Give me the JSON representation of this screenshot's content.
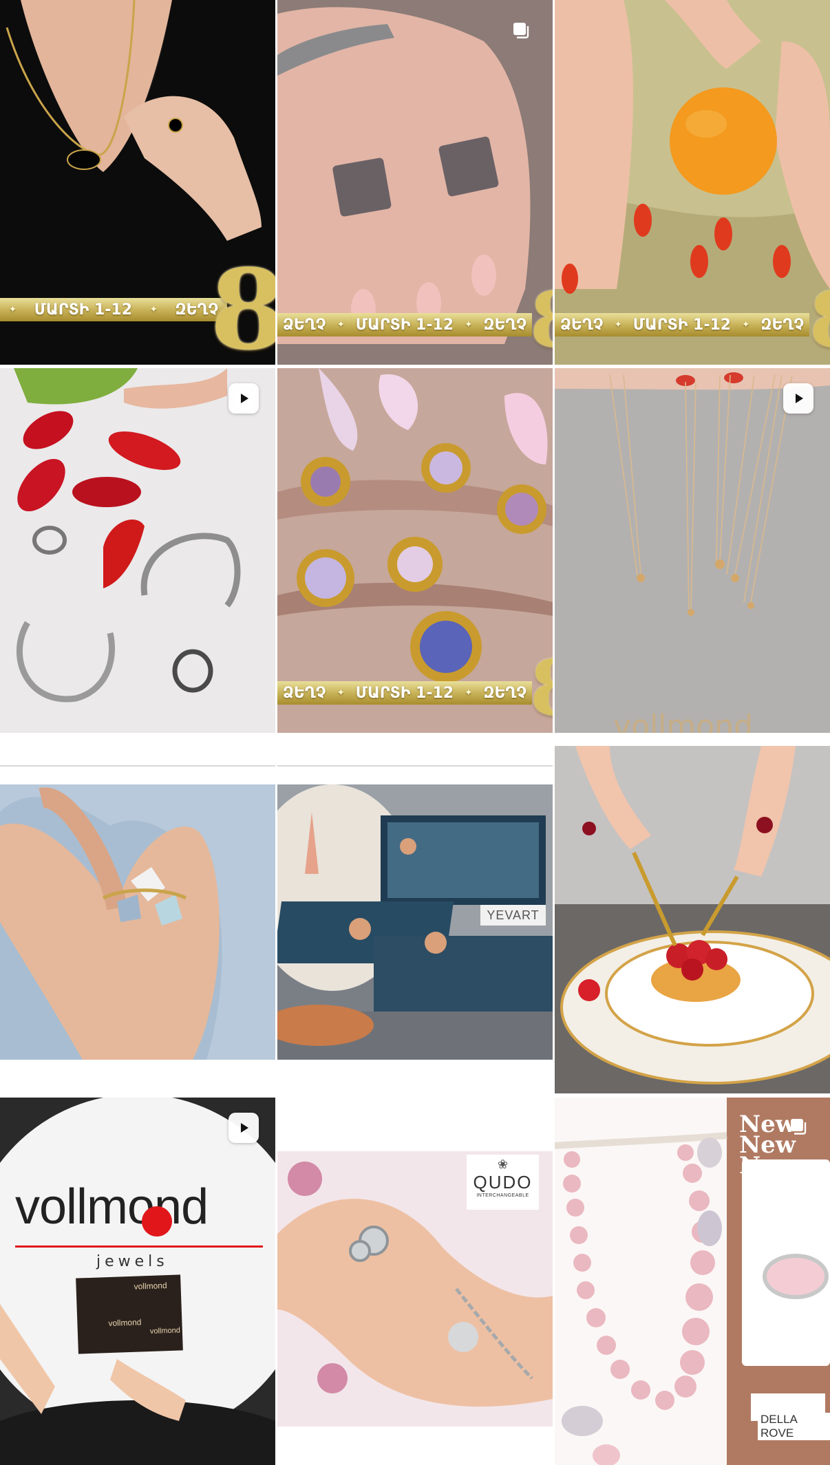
{
  "promo_banner": {
    "left_word": "ՁԵՂՉ",
    "center_text": "ՄԱՐՏԻ 1-12",
    "right_word": "ԶԵՂՉ",
    "numeral": "8"
  },
  "posts": [
    {
      "id_label": "post-1",
      "type": "image"
    },
    {
      "id_label": "post-2",
      "type": "carousel"
    },
    {
      "id_label": "post-3",
      "type": "image"
    },
    {
      "id_label": "post-4",
      "type": "reel"
    },
    {
      "id_label": "post-5",
      "type": "image"
    },
    {
      "id_label": "post-6",
      "type": "reel"
    },
    {
      "id_label": "post-7",
      "type": "image"
    },
    {
      "id_label": "post-8",
      "type": "image"
    },
    {
      "id_label": "post-9",
      "type": "image"
    },
    {
      "id_label": "post-10",
      "type": "reel"
    },
    {
      "id_label": "post-11",
      "type": "image"
    },
    {
      "id_label": "post-12",
      "type": "carousel"
    }
  ],
  "watermarks": {
    "vollmond_faded": "vollmond",
    "yevart": "YEVART"
  },
  "vollmond_logo": {
    "name": "vollmond",
    "sub": "jewels"
  },
  "vollmond_card": "vollmond",
  "qudo_logo": {
    "name": "QUDO",
    "sub": "INTERCHANGEABLE"
  },
  "new_panel": {
    "line1": "New",
    "line2": "New",
    "line3": "New"
  },
  "della_rovere": "DELLA ROVE",
  "colors": {
    "gold": "#c9b35a",
    "vollmond_red": "#e0161b",
    "terracotta": "#b07a62"
  },
  "icons": {
    "carousel": "carousel-icon",
    "reel": "reel-play-icon"
  }
}
